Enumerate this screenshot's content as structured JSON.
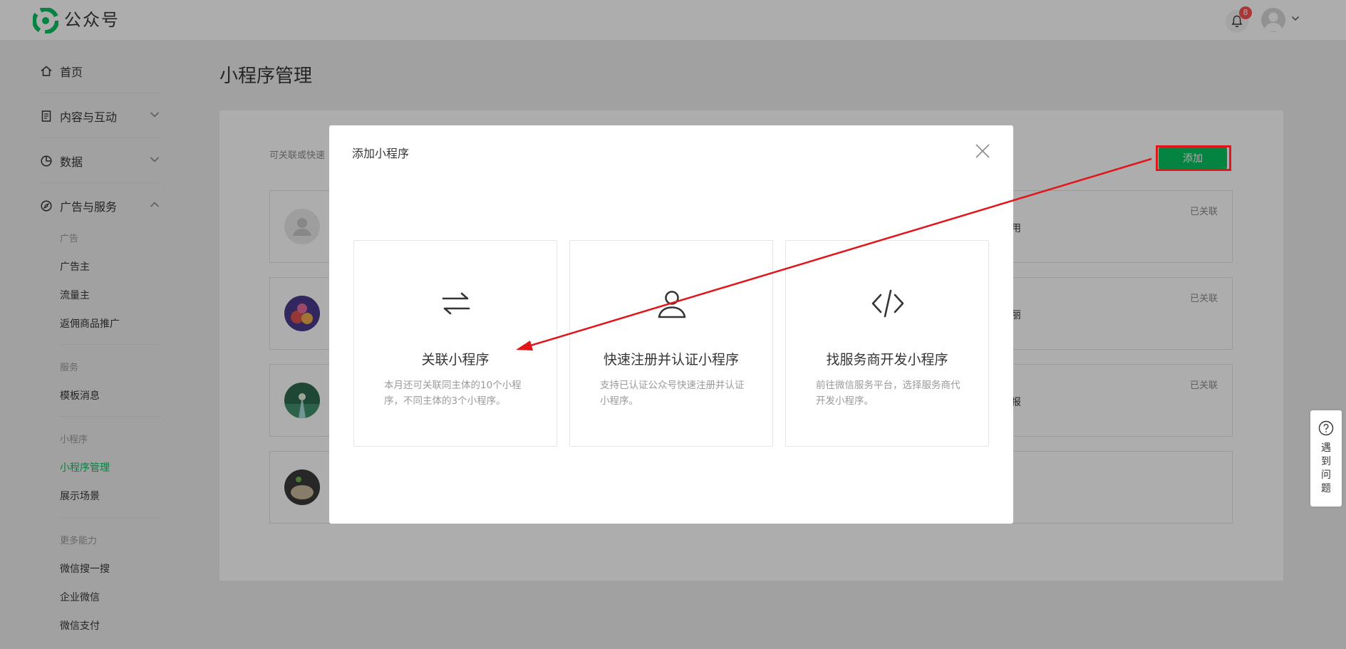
{
  "app": {
    "brand": "公众号",
    "notification_count": "8",
    "icons": {
      "logo": "wechat-official-logo",
      "bell": "bell-icon",
      "avatar": "user-avatar",
      "caret": "chevron-down-icon"
    }
  },
  "sidebar": {
    "home": "首页",
    "content": "内容与互动",
    "data": "数据",
    "ads_services": "广告与服务",
    "groups": {
      "ads": {
        "head": "广告",
        "items": [
          "广告主",
          "流量主",
          "返佣商品推广"
        ]
      },
      "services": {
        "head": "服务",
        "items": [
          "模板消息"
        ]
      },
      "miniprogram": {
        "head": "小程序",
        "items": [
          "小程序管理",
          "展示场景"
        ]
      },
      "more": {
        "head": "更多能力",
        "items": [
          "微信搜一搜",
          "企业微信",
          "微信支付"
        ]
      }
    },
    "active_item": "小程序管理"
  },
  "main": {
    "title": "小程序管理",
    "hint": "可关联或快速",
    "add_button": "添加",
    "rows": [
      {
        "status": "已关联",
        "snippet": "用"
      },
      {
        "status": "已关联",
        "snippet": "丽"
      },
      {
        "status": "已关联",
        "snippet": "报"
      },
      {
        "status": "",
        "snippet": ""
      }
    ]
  },
  "modal": {
    "title": "添加小程序",
    "options": [
      {
        "icon": "link-arrows-icon",
        "title": "关联小程序",
        "desc": "本月还可关联同主体的10个小程序，不同主体的3个小程序。"
      },
      {
        "icon": "person-icon",
        "title": "快速注册并认证小程序",
        "desc": "支持已认证公众号快速注册并认证小程序。"
      },
      {
        "icon": "code-icon",
        "title": "找服务商开发小程序",
        "desc": "前往微信服务平台，选择服务商代开发小程序。"
      }
    ]
  },
  "help": {
    "label": "遇到问题"
  },
  "colors": {
    "brand_green": "#07c160",
    "annotation_red": "#e0161a",
    "badge_red": "#fa5151"
  }
}
